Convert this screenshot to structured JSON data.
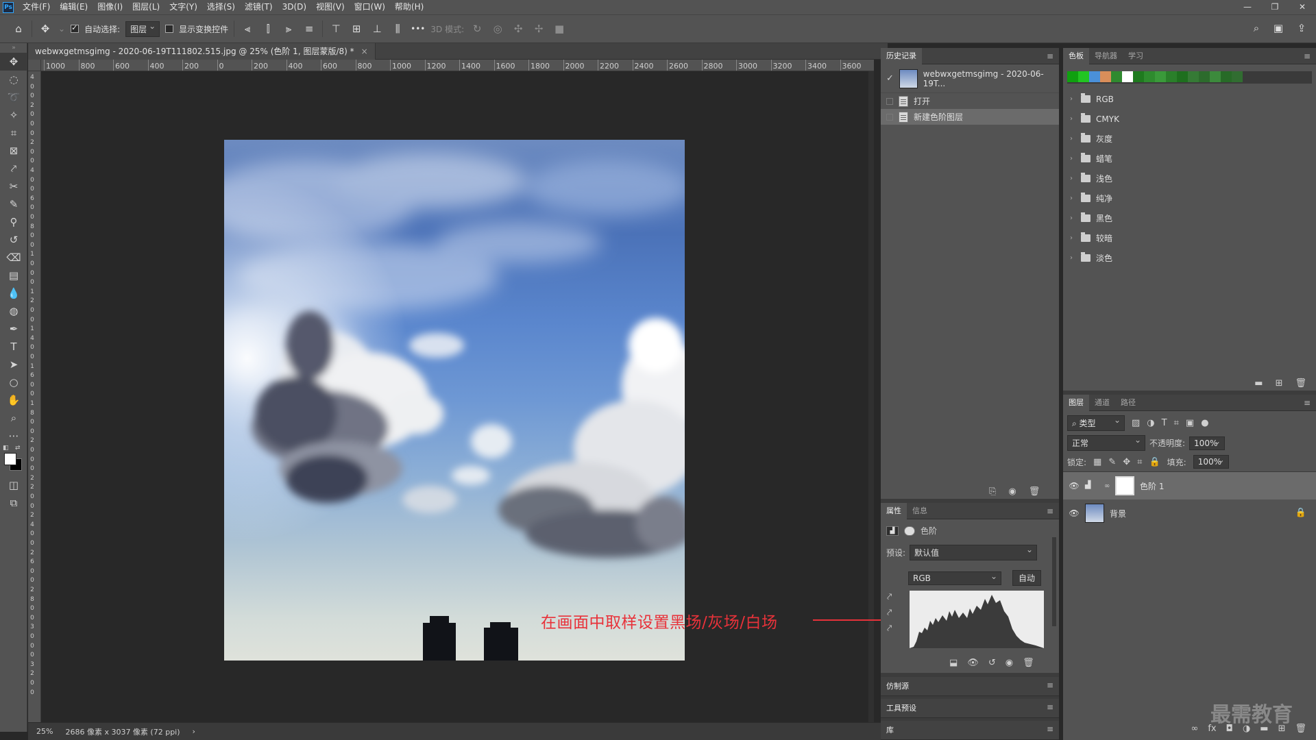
{
  "menu": {
    "logo": "Ps",
    "items": [
      "文件(F)",
      "编辑(E)",
      "图像(I)",
      "图层(L)",
      "文字(Y)",
      "选择(S)",
      "滤镜(T)",
      "3D(D)",
      "视图(V)",
      "窗口(W)",
      "帮助(H)"
    ],
    "window_buttons": [
      "—",
      "❐",
      "✕"
    ]
  },
  "options": {
    "auto_select_label": "自动选择:",
    "auto_select_value": "图层",
    "show_transform_label": "显示变换控件",
    "mode_3d_label": "3D 模式:",
    "more": "•••"
  },
  "document": {
    "tab_title": "webwxgetmsgimg - 2020-06-19T111802.515.jpg @ 25% (色阶 1, 图层蒙版/8) *",
    "close": "×"
  },
  "ruler": {
    "h_labels": [
      "1000",
      "800",
      "600",
      "400",
      "200",
      "0",
      "200",
      "400",
      "600",
      "800",
      "1000",
      "1200",
      "1400",
      "1600",
      "1800",
      "2000",
      "2200",
      "2400",
      "2600",
      "2800",
      "3000",
      "3200",
      "3400",
      "3600"
    ],
    "v_labels": [
      "4",
      "0",
      "0",
      "2",
      "0",
      "0",
      "0",
      "2",
      "0",
      "0",
      "4",
      "0",
      "0",
      "6",
      "0",
      "0",
      "8",
      "0",
      "0",
      "1",
      "0",
      "0",
      "0",
      "1",
      "2",
      "0",
      "0",
      "1",
      "4",
      "0",
      "0",
      "1",
      "6",
      "0",
      "0",
      "1",
      "8",
      "0",
      "0",
      "2",
      "0",
      "0",
      "0",
      "2",
      "2",
      "0",
      "0",
      "2",
      "4",
      "0",
      "0",
      "2",
      "6",
      "0",
      "0",
      "2",
      "8",
      "0",
      "0",
      "3",
      "0",
      "0",
      "0",
      "3",
      "2",
      "0",
      "0"
    ]
  },
  "status": {
    "zoom": "25%",
    "doc_info": "2686 像素 x 3037 像素 (72 ppi)",
    "chevron": "›"
  },
  "annotation": {
    "text": "在画面中取样设置黑场/灰场/白场"
  },
  "history": {
    "tab": "历史记录",
    "snapshot": "webwxgetmsgimg - 2020-06-19T...",
    "items": [
      "打开",
      "新建色阶图层"
    ]
  },
  "properties": {
    "tabs": [
      "属性",
      "信息"
    ],
    "adjust_label": "色阶",
    "preset_label": "预设:",
    "preset_value": "默认值",
    "channel_value": "RGB",
    "auto_button": "自动"
  },
  "bottom_panels": [
    "仿制源",
    "工具预设",
    "库"
  ],
  "swatches": {
    "tabs": [
      "色板",
      "导航器",
      "学习"
    ],
    "colors": [
      "#10a010",
      "#22c422",
      "#4a90d9",
      "#d98e5a",
      "#2f8a2f",
      "#ffffff",
      "#1f7a1f",
      "#2e8b2e",
      "#3a9a3a",
      "#2a7f2a",
      "#1e6f1e",
      "#357a35",
      "#2c6b2c",
      "#3c8a3c",
      "#276a27",
      "#316d31"
    ],
    "groups": [
      "RGB",
      "CMYK",
      "灰度",
      "蜡笔",
      "浅色",
      "纯净",
      "黑色",
      "较暗",
      "淡色"
    ]
  },
  "layers_panel": {
    "tabs": [
      "图层",
      "通道",
      "路径"
    ],
    "filter_label": "类型",
    "blend_mode": "正常",
    "opacity_label": "不透明度:",
    "opacity_value": "100%",
    "lock_label": "锁定:",
    "fill_label": "填充:",
    "fill_value": "100%",
    "layers": [
      {
        "name": "色阶 1",
        "selected": true
      },
      {
        "name": "背景",
        "selected": false
      }
    ]
  },
  "watermark": "最需教育"
}
